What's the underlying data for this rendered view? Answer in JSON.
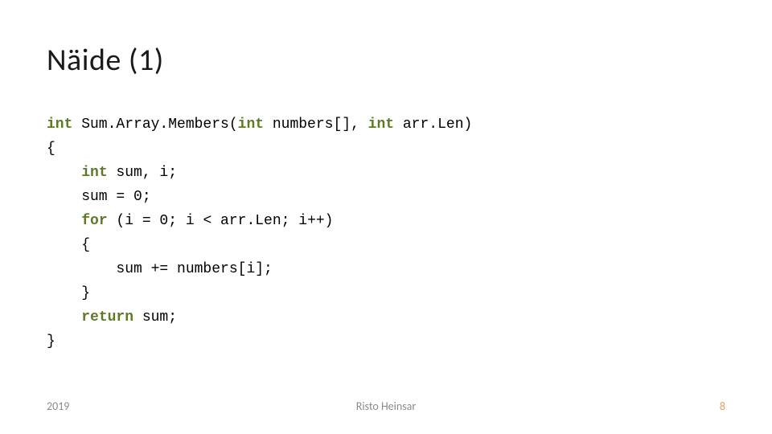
{
  "title": "Näide (1)",
  "code": {
    "line1_kw": "int",
    "line1_rest": " Sum.Array.Members(",
    "line1_kw2": "int",
    "line1_rest2": " numbers[], ",
    "line1_kw3": "int",
    "line1_rest3": " arr.Len)",
    "line2": "{",
    "line3_indent": "    ",
    "line3_kw": "int",
    "line3_rest": " sum, i;",
    "line4": "    sum = 0;",
    "line5_indent": "    ",
    "line5_kw": "for",
    "line5_rest": " (i = 0; i < arr.Len; i++)",
    "line6": "    {",
    "line7": "        sum += numbers[i];",
    "line8": "    }",
    "line9_indent": "    ",
    "line9_kw": "return",
    "line9_rest": " sum;",
    "line10": "}"
  },
  "footer": {
    "year": "2019",
    "author": "Risto Heinsar",
    "page": "8"
  }
}
